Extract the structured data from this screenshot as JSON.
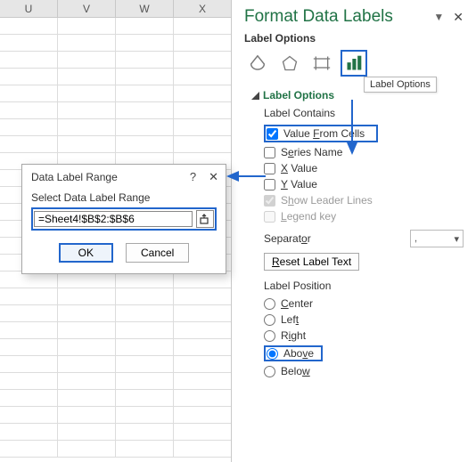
{
  "sheet": {
    "columns": [
      "U",
      "V",
      "W",
      "X"
    ]
  },
  "pane": {
    "title": "Format Data Labels",
    "sectionLabel": "Label Options",
    "tooltip": "Label Options",
    "subhead": "Label Options",
    "labelContains": "Label Contains",
    "opts": {
      "valueFromCells": "Value From Cells",
      "seriesName": "Series Name",
      "xValue": "X Value",
      "yValue": "Y Value",
      "showLeader": "Show Leader Lines",
      "legendKey": "Legend key"
    },
    "separatorLabel": "Separator",
    "separatorValue": ",",
    "resetLabel": "Reset Label Text",
    "labelPosition": "Label Position",
    "pos": {
      "center": "Center",
      "left": "Left",
      "right": "Right",
      "above": "Above",
      "below": "Below"
    }
  },
  "dialog": {
    "title": "Data Label Range",
    "fieldLabel": "Select Data Label Range",
    "value": "=Sheet4!$B$2:$B$6",
    "ok": "OK",
    "cancel": "Cancel"
  }
}
